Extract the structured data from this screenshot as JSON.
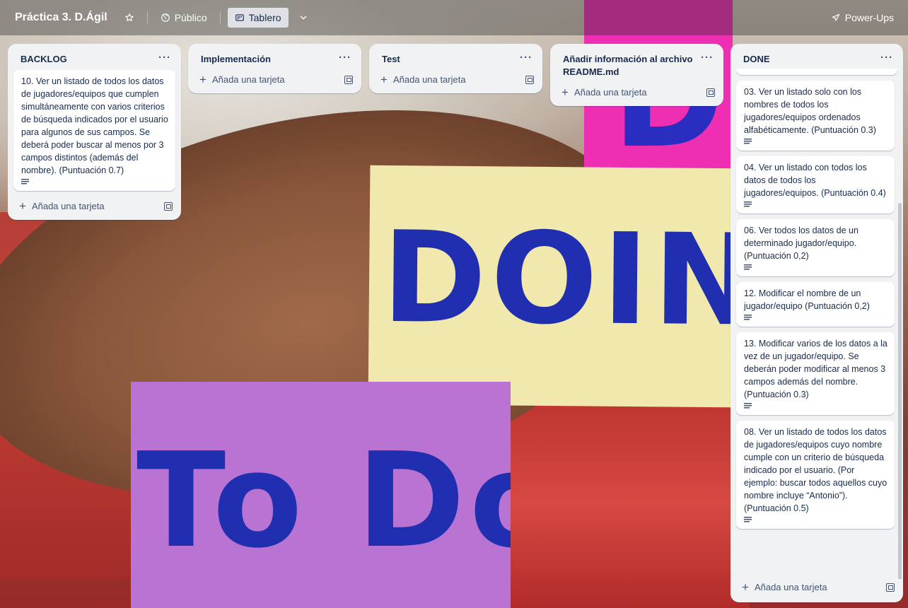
{
  "header": {
    "board_title": "Práctica 3. D.Ágil",
    "visibility_label": "Público",
    "view_label": "Tablero",
    "powerups_label": "Power-Ups"
  },
  "background": {
    "note_doing": "DOING",
    "note_todo": "To Do",
    "note_done": "Do"
  },
  "lists": [
    {
      "title": "BACKLOG",
      "cards": [
        {
          "text": "10. Ver un listado de todos los datos de jugadores/equipos que cumplen simultáneamente con varios criterios de búsqueda indicados por el usuario para algunos de sus campos. Se deberá poder buscar al menos por 3 campos distintos (además del nombre). (Puntuación 0.7)"
        }
      ],
      "add_label": "Añada una tarjeta"
    },
    {
      "title": "Implementación",
      "cards": [],
      "add_label": "Añada una tarjeta"
    },
    {
      "title": "Test",
      "cards": [],
      "add_label": "Añada una tarjeta"
    },
    {
      "title": "Añadir información al archivo README.md",
      "cards": [],
      "add_label": "Añada una tarjeta"
    },
    {
      "title": "DONE",
      "cards": [
        {
          "text": "03. Ver un listado solo con los nombres de todos los jugadores/equipos ordenados alfabéticamente. (Puntuación 0.3)"
        },
        {
          "text": "04. Ver un listado con todos los datos de todos los jugadores/equipos. (Puntuación 0.4)"
        },
        {
          "text": "06. Ver todos los datos de un determinado jugador/equipo. (Puntuación 0,2)"
        },
        {
          "text": "12. Modificar el nombre de un jugador/equipo (Puntuación 0,2)"
        },
        {
          "text": "13. Modificar varios de los datos a la vez de un jugador/equipo. Se deberán poder modificar al menos 3 campos además del nombre. (Puntuación 0.3)"
        },
        {
          "text": "08. Ver un listado de todos los datos de jugadores/equipos cuyo nombre cumple con un criterio de búsqueda indicado por el usuario. (Por ejemplo: buscar todos aquellos cuyo nombre incluye “Antonio”). (Puntuación 0.5)"
        }
      ],
      "add_label": "Añada una tarjeta"
    }
  ],
  "icons": {
    "star": "star-icon",
    "globe": "globe-icon",
    "board": "board-icon",
    "chevron": "chevron-down-icon",
    "powerups": "rocket-icon",
    "list_menu": "more-icon",
    "add": "plus-icon",
    "template": "template-icon",
    "description": "description-icon"
  }
}
